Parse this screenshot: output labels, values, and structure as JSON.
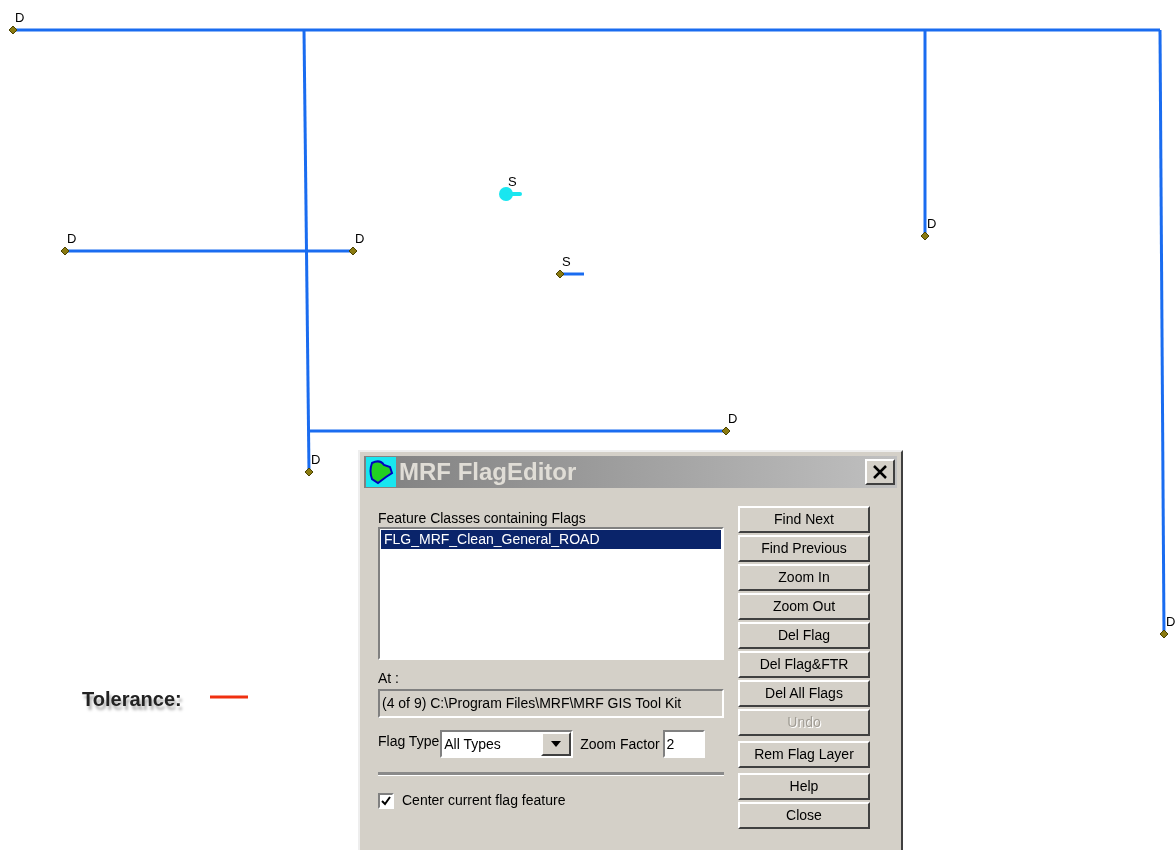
{
  "map": {
    "nodes": [
      {
        "label": "D",
        "kind": "diamond"
      },
      {
        "label": "D",
        "kind": "diamond"
      },
      {
        "label": "D",
        "kind": "diamond"
      },
      {
        "label": "S",
        "kind": "blob"
      },
      {
        "label": "S",
        "kind": "diamond"
      },
      {
        "label": "D",
        "kind": "diamond"
      },
      {
        "label": "D",
        "kind": "diamond"
      },
      {
        "label": "D",
        "kind": "diamond"
      },
      {
        "label": "D",
        "kind": "diamond"
      }
    ],
    "tolerance": {
      "label": "Tolerance:"
    }
  },
  "dialog": {
    "title": "MRF FlagEditor",
    "list_label": "Feature Classes containing Flags",
    "feature_classes": [
      {
        "name": "FLG_MRF_Clean_General_ROAD",
        "selected": true
      }
    ],
    "at_label": "At :",
    "at_value": "(4 of 9) C:\\Program Files\\MRF\\MRF GIS Tool Kit",
    "flag_type_label": "Flag Type",
    "flag_type": "All Types",
    "zoom_factor_label": "Zoom Factor",
    "zoom_factor": "2",
    "center_checkbox": {
      "label": "Center current flag feature",
      "checked": true
    },
    "button_groups": [
      [
        {
          "label": "Find Next",
          "disabled": false
        },
        {
          "label": "Find Previous",
          "disabled": false
        },
        {
          "label": "Zoom In",
          "disabled": false
        },
        {
          "label": "Zoom Out",
          "disabled": false
        },
        {
          "label": "Del Flag",
          "disabled": false
        },
        {
          "label": "Del Flag&FTR",
          "disabled": false
        },
        {
          "label": "Del All Flags",
          "disabled": false
        },
        {
          "label": "Undo",
          "disabled": true
        }
      ],
      [
        {
          "label": "Rem Flag Layer",
          "disabled": false
        }
      ],
      [
        {
          "label": "Help",
          "disabled": false
        },
        {
          "label": "Close",
          "disabled": false
        }
      ]
    ]
  }
}
